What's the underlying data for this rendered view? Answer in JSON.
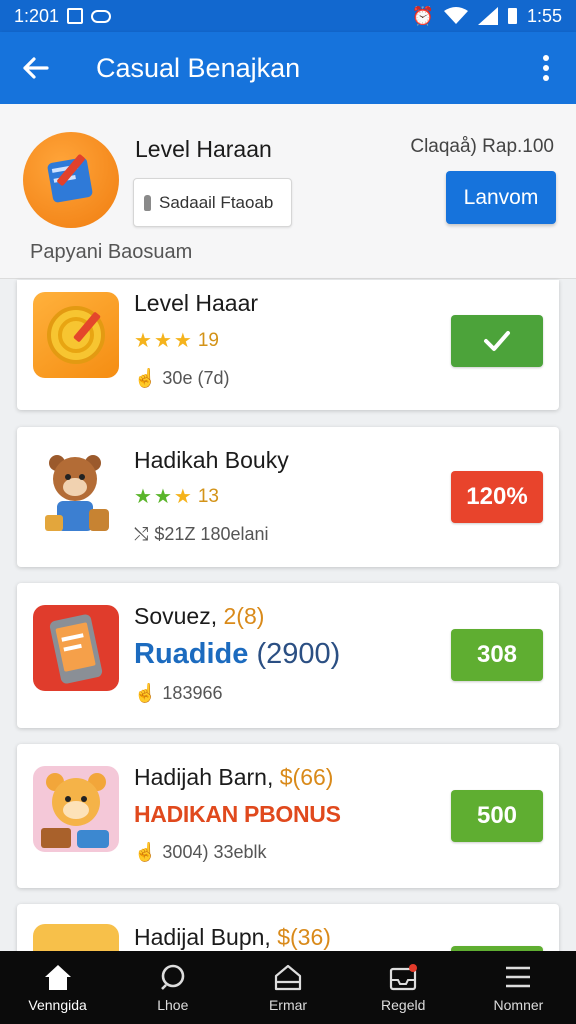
{
  "status": {
    "time_left": "1:201",
    "time_right": "1:55"
  },
  "app_bar": {
    "title": "Casual Benajkan"
  },
  "header": {
    "title": "Level Haraan",
    "chip_label": "Sadaail Ftaoab",
    "subtitle": "Papyani Baosuam",
    "meta": "Claqaå) Rap.100",
    "button_label": "Lanvom"
  },
  "cards": [
    {
      "title": "Level Haaar",
      "rating": "19",
      "meta": "30e (7d)",
      "action": "check"
    },
    {
      "title": "Hadikah Bouky",
      "rating": "13",
      "meta": "$21Z 180elani",
      "action": "120%"
    },
    {
      "title_prefix": "Sovuez,",
      "title_accent": "2(8)",
      "headline": "Ruadide",
      "headline_paren": "(2900)",
      "meta": "183966",
      "action": "308"
    },
    {
      "title_prefix": "Hadijah Barn,",
      "title_accent": "$(66)",
      "headline": "HADIKAN PBONUS",
      "meta": "3004) 33eblk",
      "action": "500"
    },
    {
      "title_prefix": "Hadijal Bupn,",
      "title_accent": "$(36)"
    }
  ],
  "bottom_nav": [
    {
      "label": "Venngida",
      "icon": "home-icon"
    },
    {
      "label": "Lhoe",
      "icon": "search-icon"
    },
    {
      "label": "Ermar",
      "icon": "house-outline-icon"
    },
    {
      "label": "Regeld",
      "icon": "inbox-icon"
    },
    {
      "label": "Nomner",
      "icon": "menu-icon"
    }
  ],
  "colors": {
    "primary": "#1673dc",
    "green": "#4ca33a",
    "red": "#e8442c",
    "lime": "#5fae31"
  }
}
